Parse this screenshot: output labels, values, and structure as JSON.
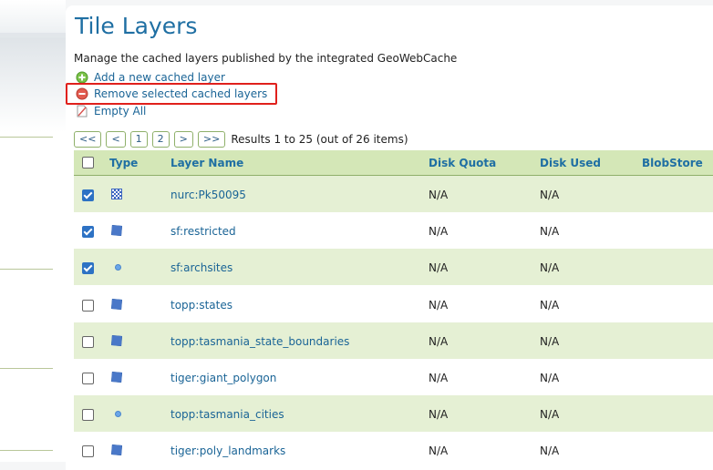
{
  "page": {
    "title": "Tile Layers",
    "description": "Manage the cached layers published by the integrated GeoWebCache"
  },
  "actions": {
    "add": "Add a new cached layer",
    "remove": "Remove selected cached layers",
    "empty": "Empty All"
  },
  "pager": {
    "first": "<<",
    "prev": "<",
    "page1": "1",
    "page2": "2",
    "next": ">",
    "last": ">>",
    "results": "Results 1 to 25 (out of 26 items)"
  },
  "table": {
    "columns": {
      "type": "Type",
      "layer_name": "Layer Name",
      "disk_quota": "Disk Quota",
      "disk_used": "Disk Used",
      "blobstore": "BlobStore"
    },
    "rows": [
      {
        "name": "nurc:Pk50095",
        "type": "raster-icon",
        "quota": "N/A",
        "used": "N/A",
        "checked": true
      },
      {
        "name": "sf:restricted",
        "type": "polygon-icon",
        "quota": "N/A",
        "used": "N/A",
        "checked": true
      },
      {
        "name": "sf:archsites",
        "type": "point-icon",
        "quota": "N/A",
        "used": "N/A",
        "checked": true
      },
      {
        "name": "topp:states",
        "type": "polygon-icon",
        "quota": "N/A",
        "used": "N/A",
        "checked": false
      },
      {
        "name": "topp:tasmania_state_boundaries",
        "type": "polygon-icon",
        "quota": "N/A",
        "used": "N/A",
        "checked": false
      },
      {
        "name": "tiger:giant_polygon",
        "type": "polygon-icon",
        "quota": "N/A",
        "used": "N/A",
        "checked": false
      },
      {
        "name": "topp:tasmania_cities",
        "type": "point-icon",
        "quota": "N/A",
        "used": "N/A",
        "checked": false
      },
      {
        "name": "tiger:poly_landmarks",
        "type": "polygon-icon",
        "quota": "N/A",
        "used": "N/A",
        "checked": false
      }
    ]
  },
  "colors": {
    "accent": "#1f6fa3",
    "header_bg": "#d4e7b7",
    "row_alt_bg": "#e5f0d4",
    "highlight": "#e0201c"
  }
}
